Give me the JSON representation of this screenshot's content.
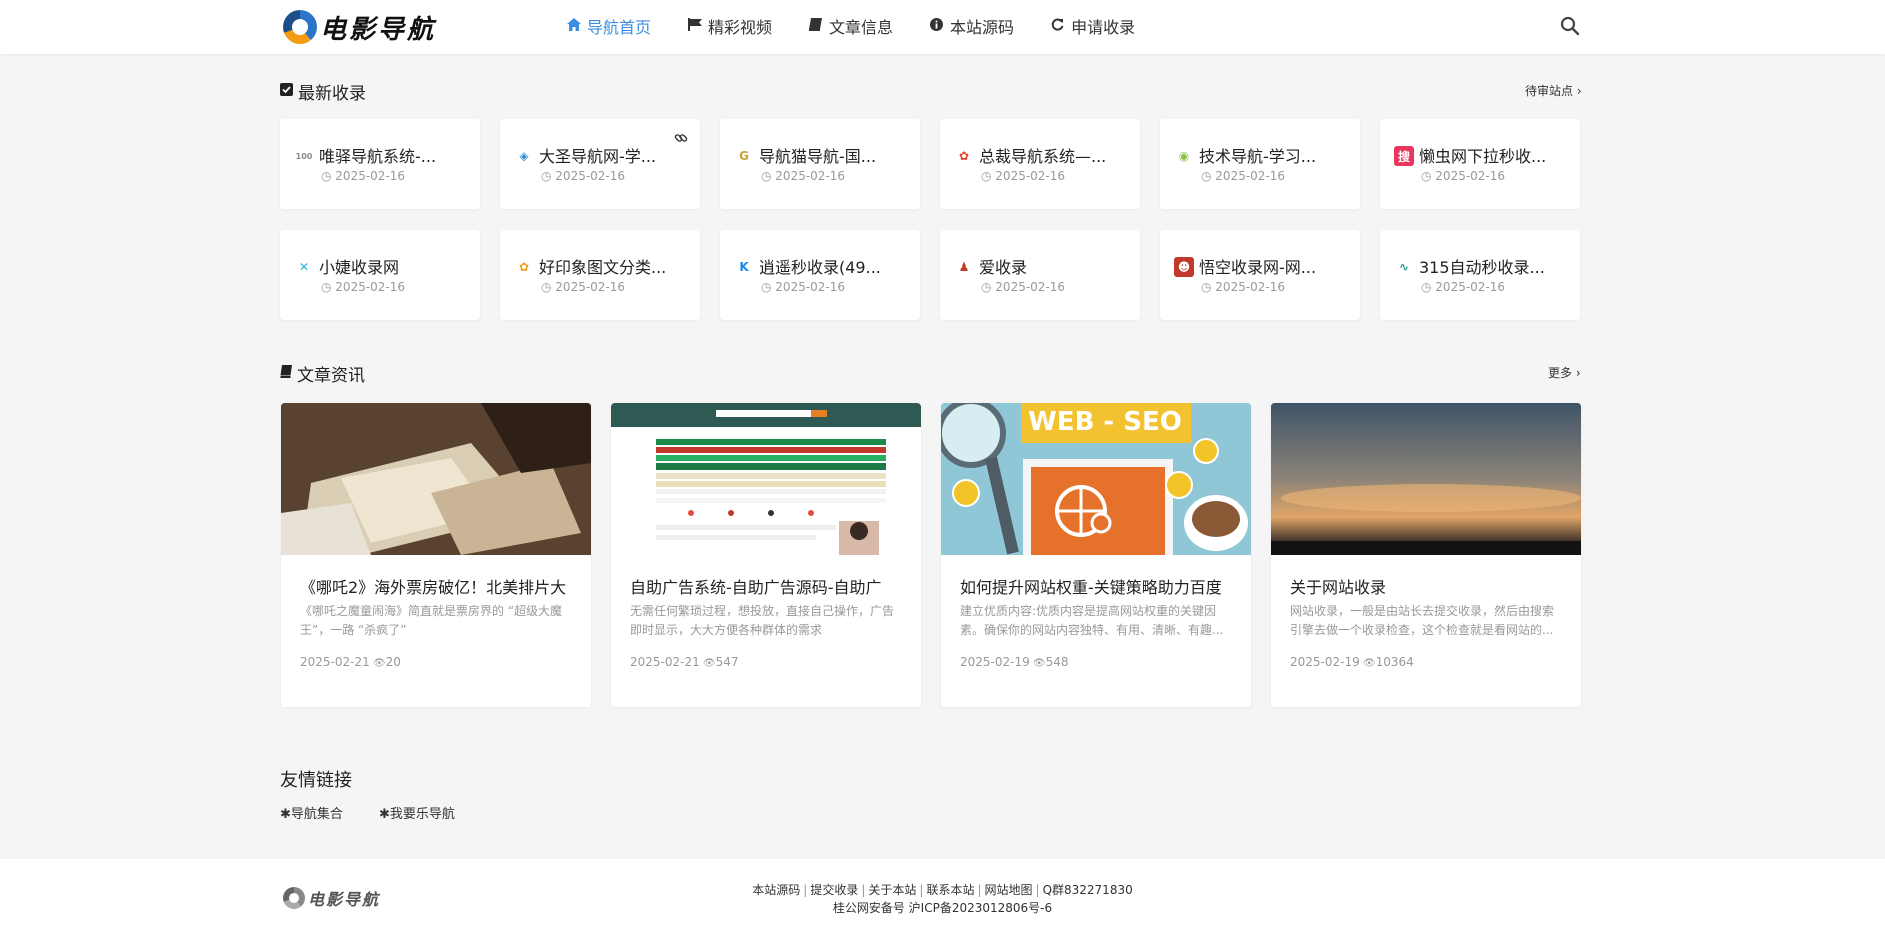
{
  "brand": {
    "name": "电影导航"
  },
  "nav": {
    "items": [
      {
        "label": "导航首页",
        "icon": "home-icon",
        "active": true
      },
      {
        "label": "精彩视频",
        "icon": "flag-icon"
      },
      {
        "label": "文章信息",
        "icon": "book-icon"
      },
      {
        "label": "本站源码",
        "icon": "info-icon"
      },
      {
        "label": "申请收录",
        "icon": "refresh-icon"
      }
    ]
  },
  "latest": {
    "title": "最新收录",
    "more": "待审站点 ›",
    "cards": [
      {
        "name": "唯驿导航系统-...",
        "date": "2025-02-16",
        "icon_text": "100",
        "icon_color": "#888888"
      },
      {
        "name": "大圣导航网-学...",
        "date": "2025-02-16",
        "icon_text": "◈",
        "icon_color": "#2b8fd8"
      },
      {
        "name": "导航猫导航-国...",
        "date": "2025-02-16",
        "icon_text": "G",
        "icon_color": "#c9a23a"
      },
      {
        "name": "总裁导航系统—...",
        "date": "2025-02-16",
        "icon_text": "✿",
        "icon_color": "#e6402e"
      },
      {
        "name": "技术导航-学习...",
        "date": "2025-02-16",
        "icon_text": "◉",
        "icon_color": "#8bc34a"
      },
      {
        "name": "懒虫网下拉秒收...",
        "date": "2025-02-16",
        "icon_text": "搜",
        "icon_color": "#e8365d"
      },
      {
        "name": "小婕收录网",
        "date": "2025-02-16",
        "icon_text": "✕",
        "icon_color": "#1fb6d8"
      },
      {
        "name": "好印象图文分类...",
        "date": "2025-02-16",
        "icon_text": "✿",
        "icon_color": "#f0a020"
      },
      {
        "name": "逍遥秒收录(49...",
        "date": "2025-02-16",
        "icon_text": "K",
        "icon_color": "#1e88e5"
      },
      {
        "name": "爱收录",
        "date": "2025-02-16",
        "icon_text": "♟",
        "icon_color": "#c0392b"
      },
      {
        "name": "悟空收录网-网...",
        "date": "2025-02-16",
        "icon_text": "☻",
        "icon_color": "#c0392b"
      },
      {
        "name": "315自动秒收录...",
        "date": "2025-02-16",
        "icon_text": "∿",
        "icon_color": "#2a9d8f"
      }
    ]
  },
  "articles": {
    "title": "文章资讯",
    "more": "更多 ›",
    "items": [
      {
        "title": "《哪吒2》海外票房破亿！北美排片大",
        "summary": "《哪吒之魔童闹海》简直就是票房界的 “超级大魔王”，一路 “杀疯了”",
        "date": "2025-02-21",
        "views": "20"
      },
      {
        "title": "自助广告系统-自助广告源码-自助广",
        "summary": "无需任何繁琐过程，想投放，直接自己操作，广告即时显示，大大方便各种群体的需求",
        "date": "2025-02-21",
        "views": "547"
      },
      {
        "title": "如何提升网站权重-关键策略助力百度",
        "summary": "建立优质内容:优质内容是提高网站权重的关键因素。确保你的网站内容独特、有用、清晰、有趣...",
        "date": "2025-02-19",
        "views": "548"
      },
      {
        "title": "关于网站收录",
        "summary": "网站收录，一般是由站长去提交收录，然后由搜索引擎去做一个收录检查，这个检查就是看网站的...",
        "date": "2025-02-19",
        "views": "10364"
      }
    ],
    "seo_banner": "WEB - SEO"
  },
  "friends": {
    "title": "友情链接",
    "items": [
      "导航集合",
      "我要乐导航"
    ]
  },
  "footer": {
    "links": [
      "本站源码",
      "提交收录",
      "关于本站",
      "联系本站",
      "网站地图",
      "Q群832271830"
    ],
    "icp": "桂公网安备号 沪ICP备2023012806号-6"
  }
}
